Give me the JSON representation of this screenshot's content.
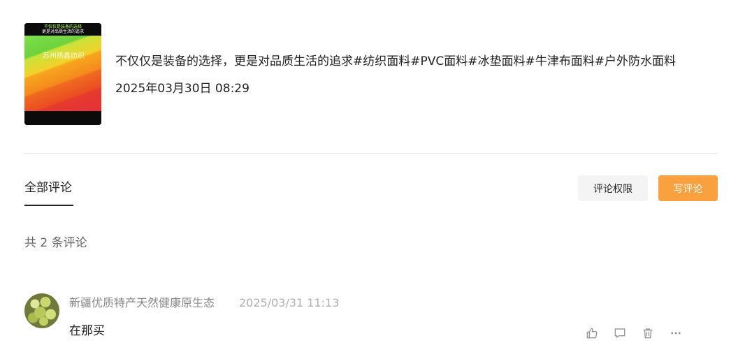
{
  "post": {
    "thumbnail": {
      "caption_line1": "不仅仅是装备的选择",
      "caption_line2": "更是对品质生活的追求",
      "brand": "苏州扬鑫纺织",
      "colors": [
        "#7be04a",
        "#f2d12a",
        "#f48a1c",
        "#ea4d22",
        "#e2313a"
      ]
    },
    "title": "不仅仅是装备的选择，更是对品质生活的追求#纺织面料#PVC面料#冰垫面料#牛津布面料#户外防水面料",
    "published_time": "2025年03月30日 08:29"
  },
  "comments_toolbar": {
    "tab_all_label": "全部评论",
    "permission_button_label": "评论权限",
    "write_button_label": "写评论",
    "accent_color": "#f9a03f"
  },
  "comments_count_text": "共 2 条评论",
  "comments": [
    {
      "author": "新疆优质特产天然健康原生态",
      "time": "2025/03/31 11:13",
      "text": "在那买",
      "actions": [
        "thumbs-up-icon",
        "comment-icon",
        "trash-icon",
        "more-icon"
      ]
    }
  ]
}
